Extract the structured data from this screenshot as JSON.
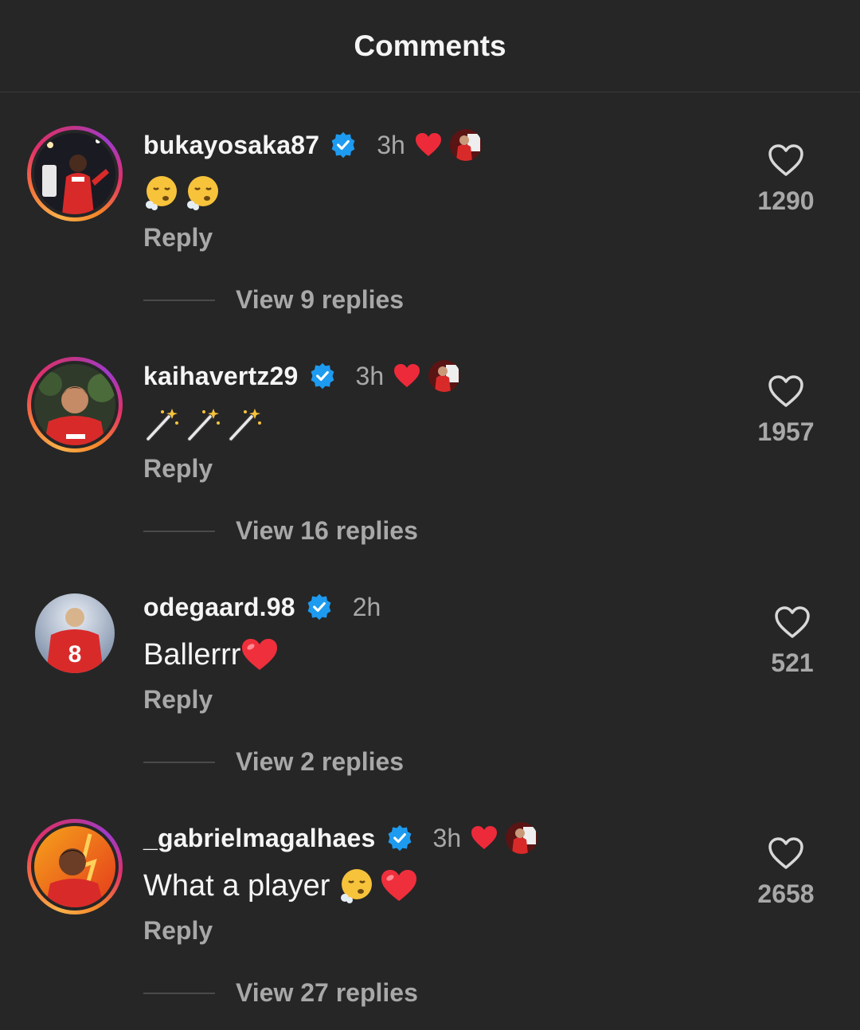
{
  "header": {
    "title": "Comments"
  },
  "colors": {
    "background": "#262626",
    "verified": "#1d9bf0",
    "heart": "#ed4956",
    "muted": "#a8a8a8"
  },
  "comments": [
    {
      "username": "bukayosaka87",
      "time": "3h",
      "text": "",
      "emoji": [
        "😮‍💨",
        "😮‍💨"
      ],
      "reply_label": "Reply",
      "view_replies": "View 9 replies",
      "likes": "1290",
      "liked_by_creator": true
    },
    {
      "username": "kaihavertz29",
      "time": "3h",
      "text": "",
      "emoji": [
        "🪄",
        "🪄",
        "🪄"
      ],
      "reply_label": "Reply",
      "view_replies": "View 16 replies",
      "likes": "1957",
      "liked_by_creator": true
    },
    {
      "username": "odegaard.98",
      "time": "2h",
      "text": "Ballerrr",
      "emoji": [
        "❤️"
      ],
      "reply_label": "Reply",
      "view_replies": "View 2 replies",
      "likes": "521",
      "liked_by_creator": false
    },
    {
      "username": "_gabrielmagalhaes",
      "time": "3h",
      "text": "What a player ",
      "emoji": [
        "😮‍💨",
        "❤️"
      ],
      "reply_label": "Reply",
      "view_replies": "View 27 replies",
      "likes": "2658",
      "liked_by_creator": true
    }
  ]
}
